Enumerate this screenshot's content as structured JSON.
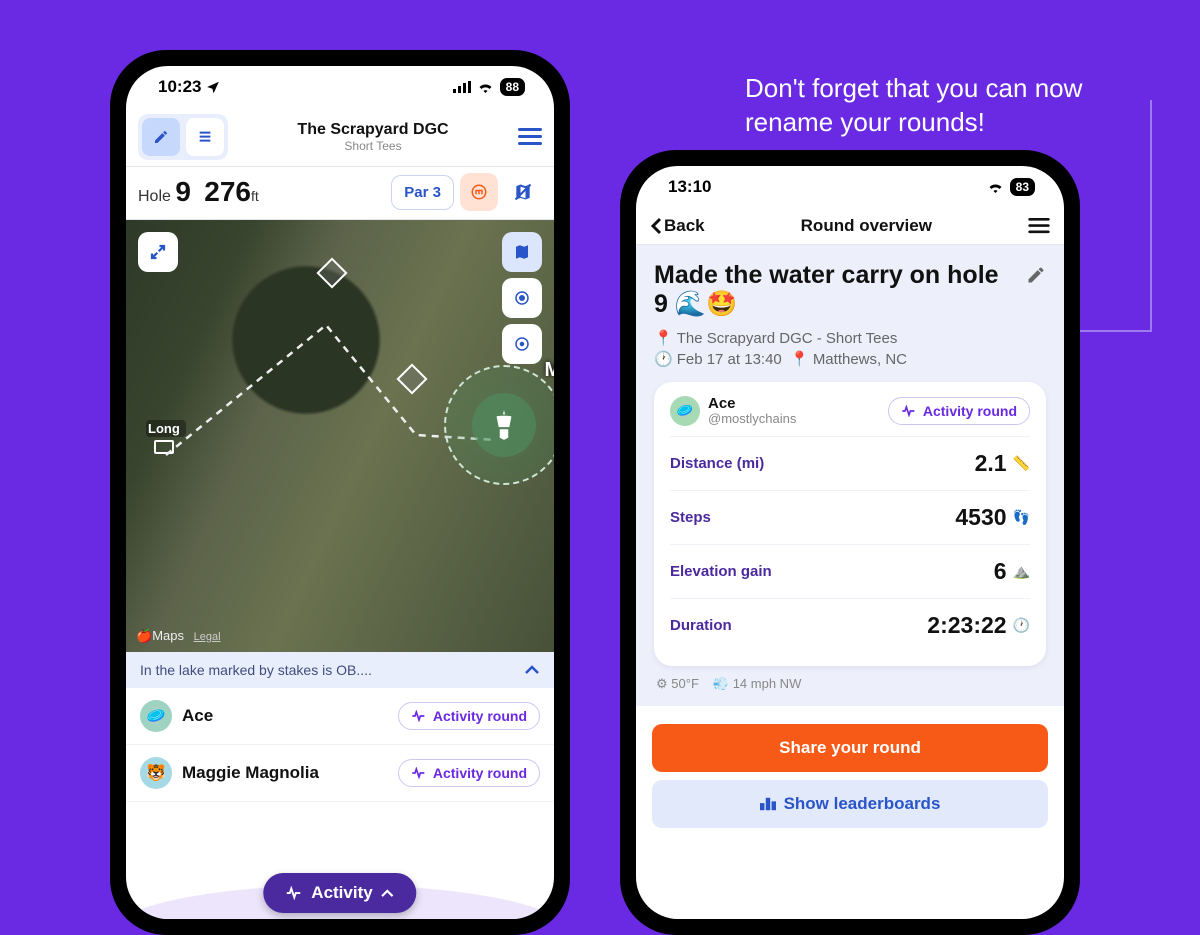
{
  "hint": "Don't forget that you can now rename your rounds!",
  "left": {
    "status": {
      "time": "10:23",
      "battery": "88"
    },
    "header": {
      "title": "The Scrapyard DGC",
      "subtitle": "Short Tees"
    },
    "hole": {
      "label": "Hole",
      "number": "9",
      "distance": "276",
      "unit": "ft",
      "par": "Par 3"
    },
    "map": {
      "long_label": "Long",
      "main_label": "Main",
      "attribution": "Maps",
      "legal": "Legal"
    },
    "note": "In the lake marked by stakes is OB....",
    "players": [
      {
        "name": "Ace",
        "tag": "Activity round"
      },
      {
        "name": "Maggie Magnolia",
        "tag": "Activity round"
      }
    ],
    "fab": "Activity"
  },
  "right": {
    "status": {
      "time": "13:10",
      "battery": "83"
    },
    "back": "Back",
    "title": "Round overview",
    "round_name": "Made the water carry on hole 9 🌊🤩",
    "course": "The Scrapyard DGC - Short Tees",
    "datetime": "Feb 17 at 13:40",
    "location": "Matthews, NC",
    "user": {
      "name": "Ace",
      "handle": "@mostlychains"
    },
    "activity_tag": "Activity round",
    "stats": {
      "distance_label": "Distance (mi)",
      "distance_val": "2.1",
      "steps_label": "Steps",
      "steps_val": "4530",
      "elev_label": "Elevation gain",
      "elev_val": "6",
      "dur_label": "Duration",
      "dur_val": "2:23:22"
    },
    "weather": {
      "temp": "50°F",
      "wind": "14 mph NW"
    },
    "share": "Share your round",
    "leaderboards": "Show leaderboards"
  }
}
